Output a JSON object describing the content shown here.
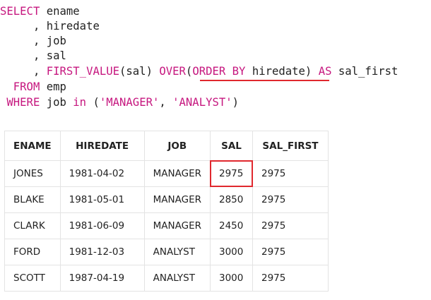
{
  "sql": {
    "select_kw": "SELECT",
    "col1": "ename",
    "col2": "hiredate",
    "col3": "job",
    "col4": "sal",
    "comma": ",",
    "first_value_fn": "FIRST_VALUE",
    "fn_arg": "(sal)",
    "over_kw": "OVER",
    "open_paren": "(",
    "order_by_kw": "ORDER BY",
    "order_col": "hiredate",
    "close_paren": ")",
    "as_kw": "AS",
    "alias": "sal_first",
    "from_kw": "FROM",
    "table": "emp",
    "where_kw": "WHERE",
    "where_col": "job",
    "in_kw": "in",
    "in_open": "(",
    "val1": "'MANAGER'",
    "in_sep": ", ",
    "val2": "'ANALYST'",
    "in_close": ")"
  },
  "result": {
    "headers": [
      "ENAME",
      "HIREDATE",
      "JOB",
      "SAL",
      "SAL_FIRST"
    ],
    "rows": [
      [
        "JONES",
        "1981-04-02",
        "MANAGER",
        "2975",
        "2975"
      ],
      [
        "BLAKE",
        "1981-05-01",
        "MANAGER",
        "2850",
        "2975"
      ],
      [
        "CLARK",
        "1981-06-09",
        "MANAGER",
        "2450",
        "2975"
      ],
      [
        "FORD",
        "1981-12-03",
        "ANALYST",
        "3000",
        "2975"
      ],
      [
        "SCOTT",
        "1987-04-19",
        "ANALYST",
        "3000",
        "2975"
      ]
    ]
  },
  "colors": {
    "keyword": "#c6177f",
    "text": "#222222",
    "highlight": "#e0282e",
    "grid": "#e3e3e3"
  }
}
